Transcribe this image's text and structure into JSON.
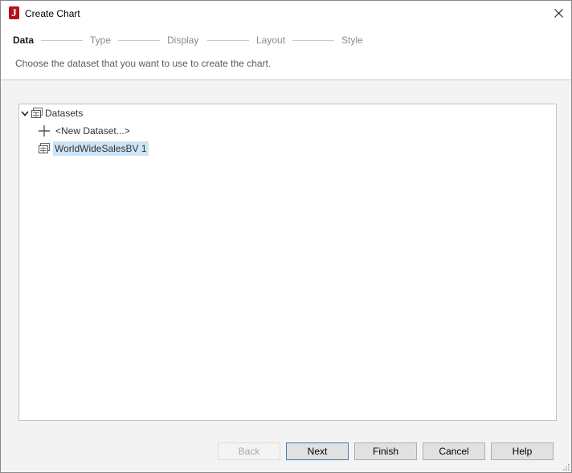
{
  "window": {
    "title": "Create Chart"
  },
  "steps": [
    {
      "label": "Data",
      "active": true
    },
    {
      "label": "Type",
      "active": false
    },
    {
      "label": "Display",
      "active": false
    },
    {
      "label": "Layout",
      "active": false
    },
    {
      "label": "Style",
      "active": false
    }
  ],
  "instruction": "Choose the dataset that you want to use to create the chart.",
  "tree": {
    "root_label": "Datasets",
    "new_dataset_label": "<New Dataset...>",
    "dataset_item_label": "WorldWideSalesBV 1"
  },
  "buttons": {
    "back": "Back",
    "next": "Next",
    "finish": "Finish",
    "cancel": "Cancel",
    "help": "Help"
  },
  "colors": {
    "accent": "#3c7fb1",
    "selection": "#cce4f7",
    "app_icon": "#b5121b"
  }
}
